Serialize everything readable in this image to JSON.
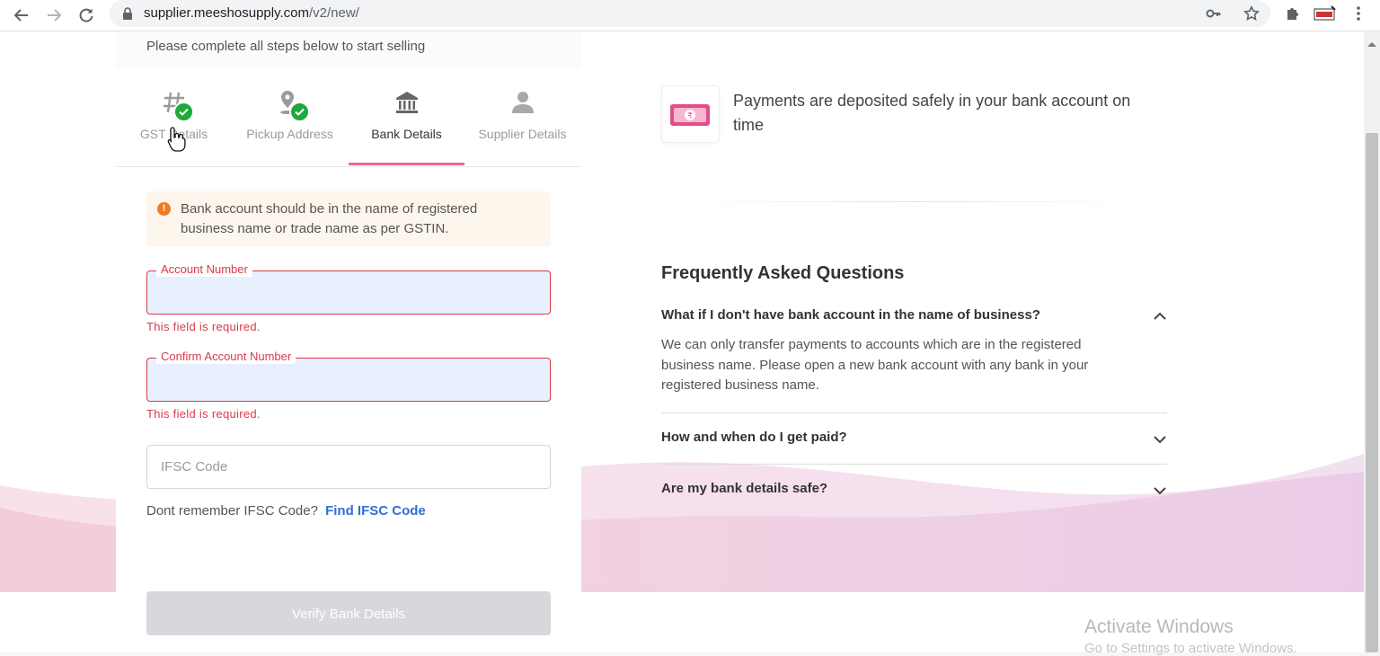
{
  "browser": {
    "url_host": "supplier.meeshosupply.com",
    "url_path": "/v2/new/"
  },
  "intro_text": "Please complete all steps below to start selling",
  "steps": [
    {
      "label": "GST Details",
      "completed": true,
      "icon": "hash-icon"
    },
    {
      "label": "Pickup Address",
      "completed": true,
      "icon": "location-pin-icon"
    },
    {
      "label": "Bank Details",
      "completed": false,
      "active": true,
      "icon": "bank-icon"
    },
    {
      "label": "Supplier Details",
      "completed": false,
      "icon": "person-icon"
    }
  ],
  "notice": "Bank account should be in the name of registered business name or trade name as per GSTIN.",
  "form": {
    "account_number_label": "Account Number",
    "account_number_error": "This field is required.",
    "confirm_account_label": "Confirm Account Number",
    "confirm_account_error": "This field is required.",
    "ifsc_placeholder": "IFSC Code",
    "ifsc_help": "Dont remember IFSC Code?",
    "ifsc_link": "Find IFSC Code",
    "verify_button": "Verify Bank Details"
  },
  "info": {
    "payment_text": "Payments are deposited safely in your bank account on time"
  },
  "faq": {
    "title": "Frequently Asked Questions",
    "items": [
      {
        "question": "What if I don't have bank account in the name of business?",
        "answer": "We can only transfer payments to accounts which are in the registered business name. Please open a new bank account with any bank in your registered business name.",
        "expanded": true
      },
      {
        "question": "How and when do I get paid?",
        "expanded": false
      },
      {
        "question": "Are my bank details safe?",
        "expanded": false
      }
    ]
  },
  "os_watermark": {
    "line1": "Activate Windows",
    "line2": "Go to Settings to activate Windows."
  },
  "colors": {
    "accent_pink": "#e86a92",
    "error_red": "#d93a4a",
    "success_green": "#1fa83b",
    "link_blue": "#2e6fd8"
  }
}
